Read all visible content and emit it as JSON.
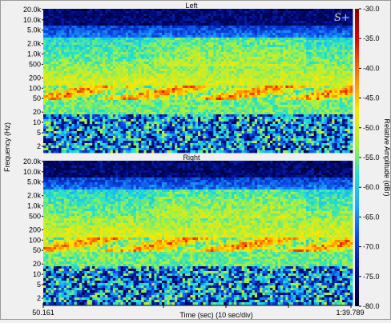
{
  "chart_data": {
    "type": "heatmap",
    "subtype": "spectrogram",
    "panels": [
      {
        "title": "Left"
      },
      {
        "title": "Right"
      }
    ],
    "watermark": "S+",
    "ylabel": "Frequency (Hz)",
    "xlabel": "Time (sec) (10 sec/div)",
    "y_scale": "log",
    "y_ticks": [
      "20.0k",
      "10.0k",
      "5.0k",
      "2.0k",
      "1.0k",
      "500",
      "200",
      "100",
      "50",
      "20",
      "10",
      "5",
      "2"
    ],
    "x_range_labels": {
      "start": "50.161",
      "end": "1:39.789"
    },
    "x_minor_divisions": 5,
    "colorbar": {
      "label": "Relative Amplitude (dBr)",
      "ticks": [
        "-30.0",
        "-35.0",
        "-40.0",
        "-45.0",
        "-50.0",
        "-55.0",
        "-60.0",
        "-65.0",
        "-70.0",
        "-75.0",
        "-80.0"
      ],
      "range": [
        -80,
        -30
      ]
    }
  }
}
